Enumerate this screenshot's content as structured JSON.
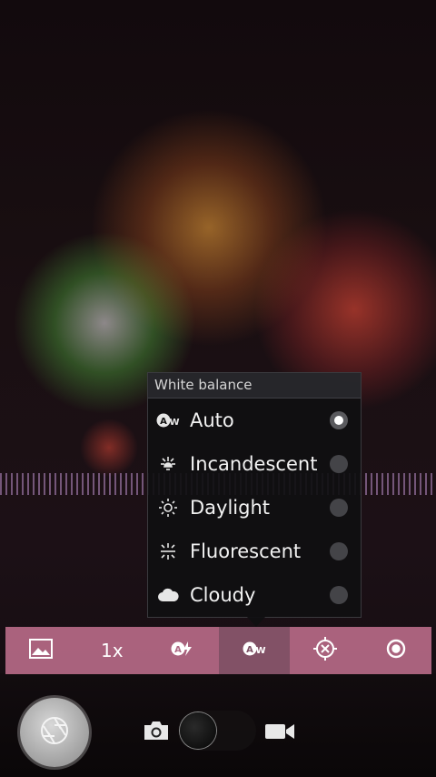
{
  "white_balance_menu": {
    "title": "White balance",
    "options": [
      {
        "label": "Auto",
        "icon": "auto-wb-icon",
        "selected": true
      },
      {
        "label": "Incandescent",
        "icon": "incandescent-icon",
        "selected": false
      },
      {
        "label": "Daylight",
        "icon": "sun-icon",
        "selected": false
      },
      {
        "label": "Fluorescent",
        "icon": "fluorescent-icon",
        "selected": false
      },
      {
        "label": "Cloudy",
        "icon": "cloud-icon",
        "selected": false
      }
    ]
  },
  "toolbar": {
    "zoom_label": "1x",
    "active_item": "white-balance",
    "items": [
      "gallery-icon",
      "zoom",
      "auto-flash-icon",
      "auto-wb-icon",
      "focus-target-icon",
      "settings-icon"
    ]
  },
  "bottom_controls": {
    "mode": "photo",
    "items": [
      "shutter-button",
      "camera-icon",
      "mode-switch",
      "video-icon"
    ]
  },
  "colors": {
    "toolbar": "#be6e8c",
    "toolbar_active": "#7d5064",
    "menu_bg": "#0f0f11"
  }
}
